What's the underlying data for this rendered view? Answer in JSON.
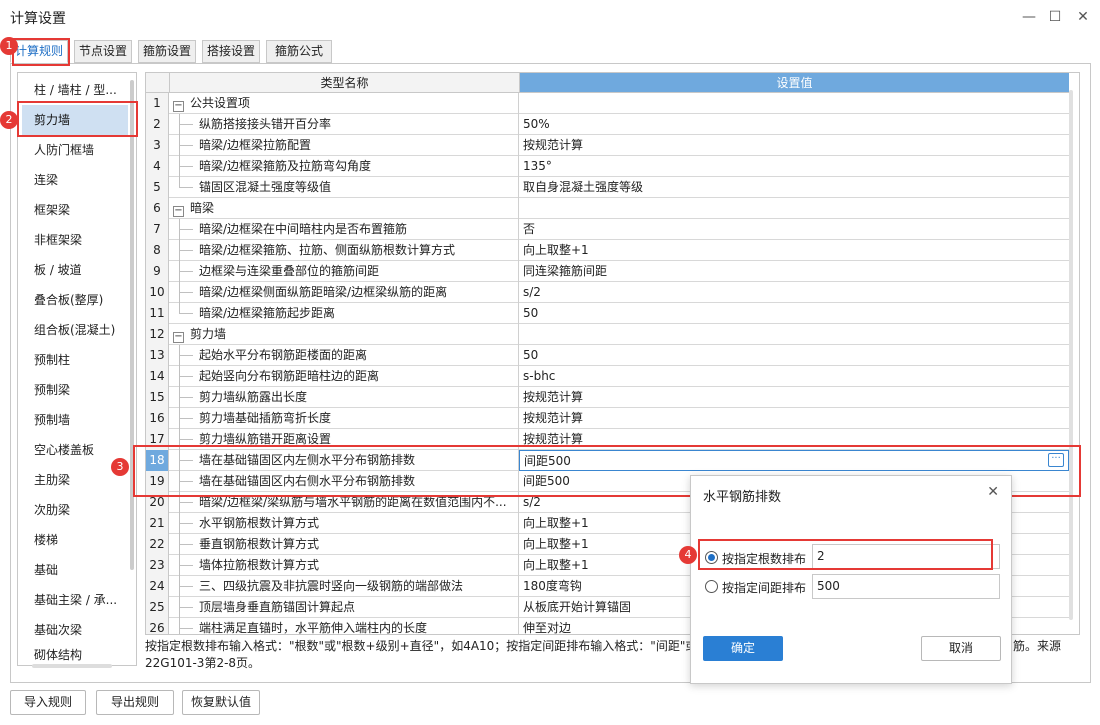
{
  "window": {
    "title": "计算设置",
    "minimize": "—",
    "maximize": "☐",
    "close": "✕"
  },
  "tabs": [
    "计算规则",
    "节点设置",
    "箍筋设置",
    "搭接设置",
    "箍筋公式"
  ],
  "sidebar": {
    "items": [
      "柱 / 墙柱 / 型...",
      "剪力墙",
      "人防门框墙",
      "连梁",
      "框架梁",
      "非框架梁",
      "板 / 坡道",
      "叠合板(整厚)",
      "组合板(混凝土)",
      "预制柱",
      "预制梁",
      "预制墙",
      "空心楼盖板",
      "主肋梁",
      "次肋梁",
      "楼梯",
      "基础",
      "基础主梁 / 承...",
      "基础次梁",
      "砌体结构"
    ],
    "selected_index": 1
  },
  "grid": {
    "col_name": "类型名称",
    "col_value": "设置值",
    "rows": [
      {
        "n": "1",
        "name": "公共设置项",
        "value": "",
        "group": true
      },
      {
        "n": "2",
        "name": "纵筋搭接接头错开百分率",
        "value": "50%"
      },
      {
        "n": "3",
        "name": "暗梁/边框梁拉筋配置",
        "value": "按规范计算"
      },
      {
        "n": "4",
        "name": "暗梁/边框梁箍筋及拉筋弯勾角度",
        "value": "135°"
      },
      {
        "n": "5",
        "name": "锚固区混凝土强度等级值",
        "value": "取自身混凝土强度等级"
      },
      {
        "n": "6",
        "name": "暗梁",
        "value": "",
        "group": true
      },
      {
        "n": "7",
        "name": "暗梁/边框梁在中间暗柱内是否布置箍筋",
        "value": "否"
      },
      {
        "n": "8",
        "name": "暗梁/边框梁箍筋、拉筋、侧面纵筋根数计算方式",
        "value": "向上取整+1"
      },
      {
        "n": "9",
        "name": "边框梁与连梁重叠部位的箍筋间距",
        "value": "同连梁箍筋间距"
      },
      {
        "n": "10",
        "name": "暗梁/边框梁侧面纵筋距暗梁/边框梁纵筋的距离",
        "value": "s/2"
      },
      {
        "n": "11",
        "name": "暗梁/边框梁箍筋起步距离",
        "value": "50"
      },
      {
        "n": "12",
        "name": "剪力墙",
        "value": "",
        "group": true
      },
      {
        "n": "13",
        "name": "起始水平分布钢筋距楼面的距离",
        "value": "50"
      },
      {
        "n": "14",
        "name": "起始竖向分布钢筋距暗柱边的距离",
        "value": "s-bhc"
      },
      {
        "n": "15",
        "name": "剪力墙纵筋露出长度",
        "value": "按规范计算"
      },
      {
        "n": "16",
        "name": "剪力墙基础插筋弯折长度",
        "value": "按规范计算"
      },
      {
        "n": "17",
        "name": "剪力墙纵筋错开距离设置",
        "value": "按规范计算"
      },
      {
        "n": "18",
        "name": "墙在基础锚固区内左侧水平分布钢筋排数",
        "value": "间距500",
        "selected": true
      },
      {
        "n": "19",
        "name": "墙在基础锚固区内右侧水平分布钢筋排数",
        "value": "间距500"
      },
      {
        "n": "20",
        "name": "暗梁/边框梁/梁纵筋与墙水平钢筋的距离在数值范围内不...",
        "value": "s/2"
      },
      {
        "n": "21",
        "name": "水平钢筋根数计算方式",
        "value": "向上取整+1"
      },
      {
        "n": "22",
        "name": "垂直钢筋根数计算方式",
        "value": "向上取整+1"
      },
      {
        "n": "23",
        "name": "墙体拉筋根数计算方式",
        "value": "向上取整+1"
      },
      {
        "n": "24",
        "name": "三、四级抗震及非抗震时竖向一级钢筋的端部做法",
        "value": "180度弯钩"
      },
      {
        "n": "25",
        "name": "顶层墙身垂直筋锚固计算起点",
        "value": "从板底开始计算锚固"
      },
      {
        "n": "26",
        "name": "端柱满足直锚时，水平筋伸入端柱内的长度",
        "value": "伸至对边"
      }
    ]
  },
  "hint": {
    "line1_left": "按指定根数排布输入格式：\"根数\"或\"根数+级别+直径\"，如4A10；按指定间距排布输入格式：\"间距\"或",
    "line1_right": "筋。来源",
    "line2": "22G101-3第2-8页。"
  },
  "bottom_buttons": [
    "导入规则",
    "导出规则",
    "恢复默认值"
  ],
  "callouts": [
    "1",
    "2",
    "3",
    "4"
  ],
  "dialog": {
    "title": "水平钢筋排数",
    "close": "✕",
    "option1_label": "按指定根数排布",
    "option1_value": "2",
    "option2_label": "按指定间距排布",
    "option2_value": "500",
    "ok": "确定",
    "cancel": "取消"
  },
  "colors": {
    "accent": "#1f6fc5",
    "header_value_bg": "#6fa9de",
    "callout_red": "#e53935",
    "sidebar_selected": "#cfe0f2"
  }
}
